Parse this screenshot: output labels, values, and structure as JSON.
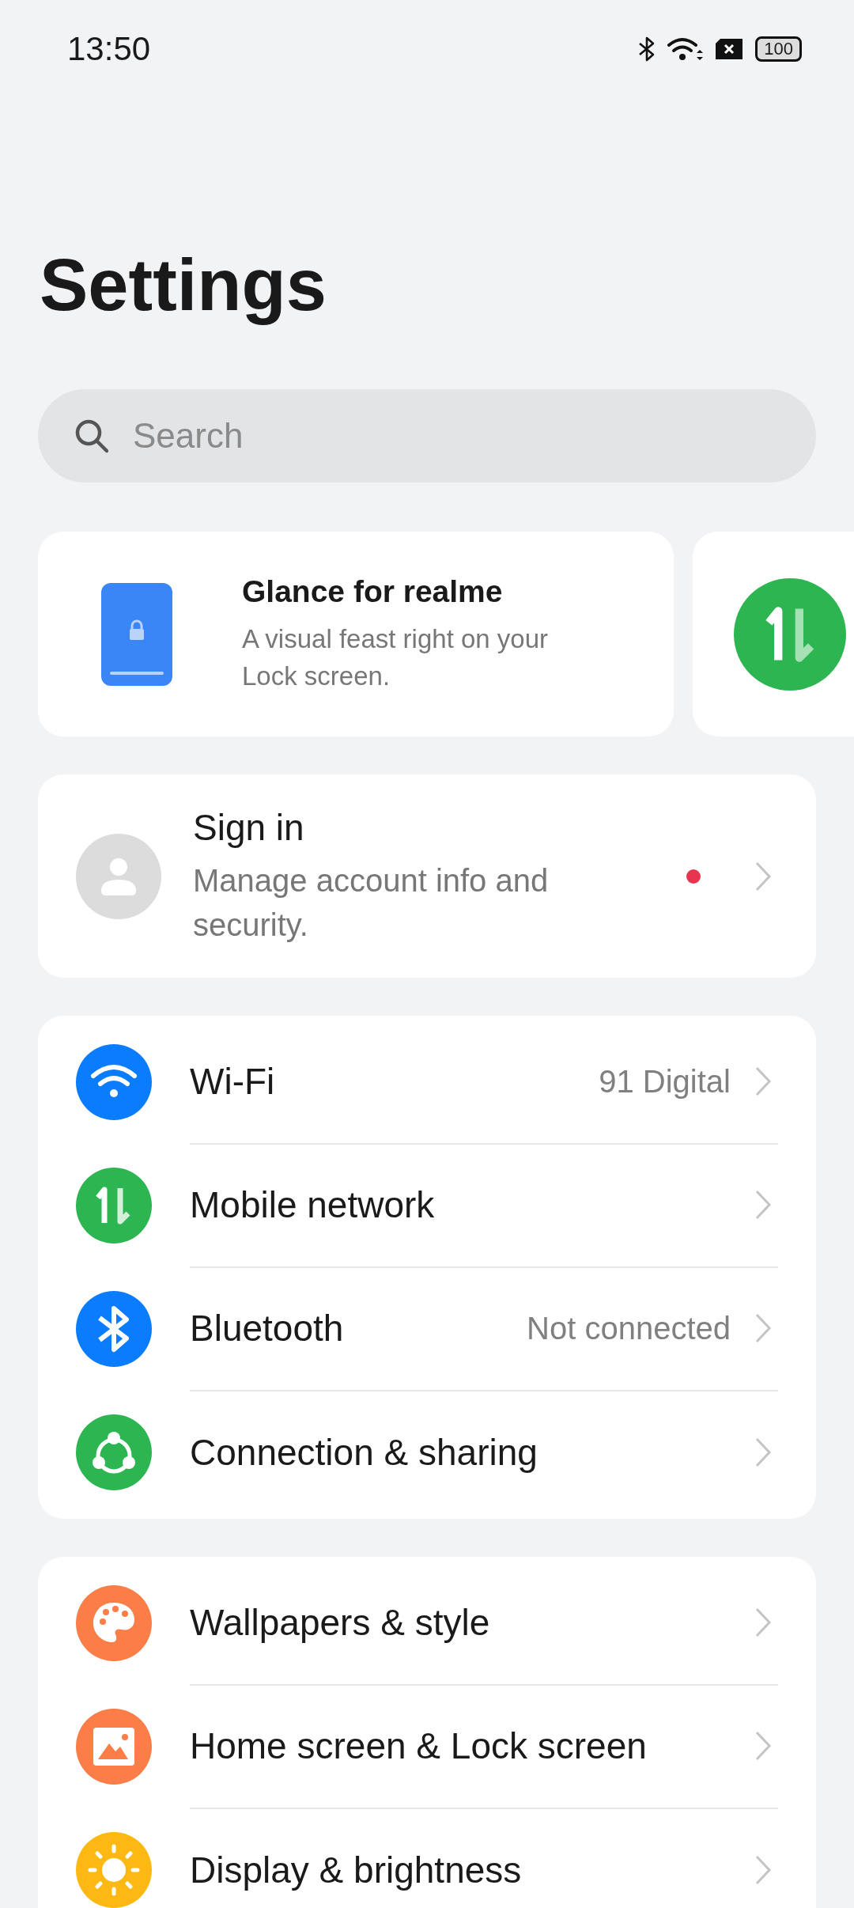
{
  "status_bar": {
    "time": "13:50",
    "battery": "100"
  },
  "title": "Settings",
  "search": {
    "placeholder": "Search"
  },
  "carousel": [
    {
      "kind": "lock-phone",
      "title": "Glance for realme",
      "description": "A visual feast right on your Lock screen."
    },
    {
      "kind": "data-arrows"
    }
  ],
  "account": {
    "title": "Sign in",
    "subtitle": "Manage account info and security.",
    "badge": true
  },
  "groups": [
    [
      {
        "kind": "wifi",
        "color": "#0a7cff",
        "label": "Wi-Fi",
        "value": "91 Digital"
      },
      {
        "kind": "data-arrows",
        "color": "#2db552",
        "label": "Mobile network"
      },
      {
        "kind": "bluetooth",
        "color": "#0a7cff",
        "label": "Bluetooth",
        "value": "Not connected"
      },
      {
        "kind": "share",
        "color": "#2db552",
        "label": "Connection & sharing"
      }
    ],
    [
      {
        "kind": "palette",
        "color": "#fb7d48",
        "label": "Wallpapers & style"
      },
      {
        "kind": "picture",
        "color": "#fb7d48",
        "label": "Home screen & Lock screen"
      },
      {
        "kind": "sun",
        "color": "#fdb813",
        "label": "Display & brightness"
      }
    ]
  ]
}
